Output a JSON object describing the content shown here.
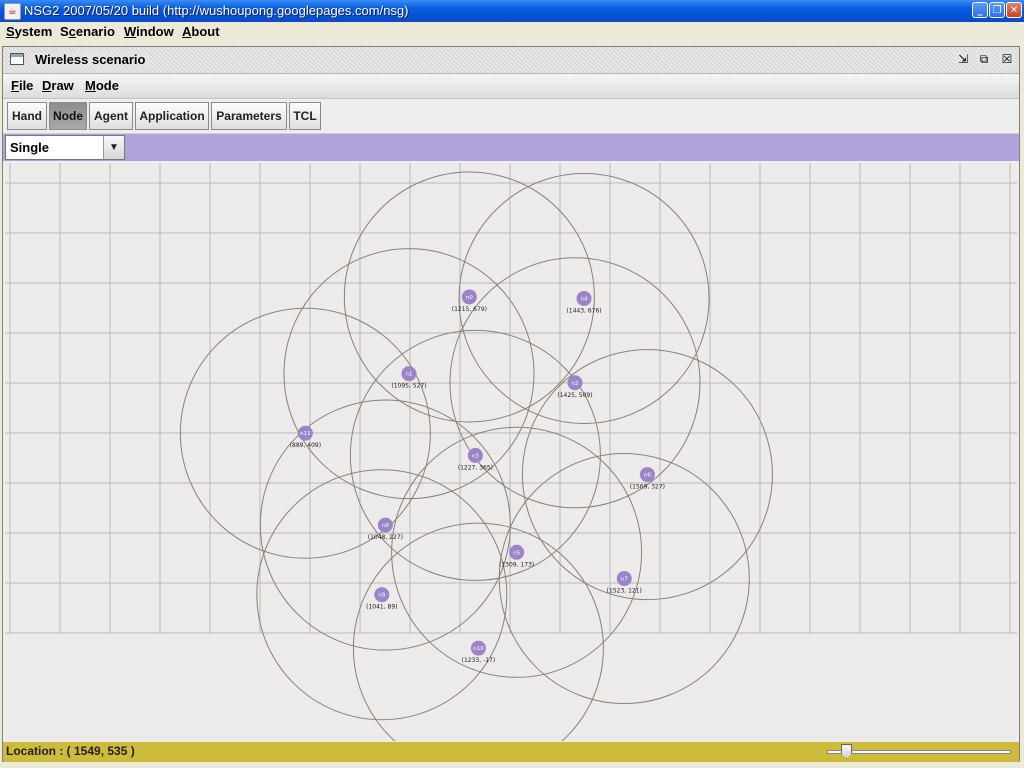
{
  "window": {
    "title": "NSG2 2007/05/20 build (http://wushoupong.googlepages.com/nsg)",
    "app_icon": "java-cup-icon",
    "controls": [
      "minimize-icon",
      "maximize-icon",
      "close-icon"
    ]
  },
  "menubar": {
    "items": [
      {
        "label": "System",
        "mnemonic": "S"
      },
      {
        "label": "Scenario",
        "mnemonic": "c"
      },
      {
        "label": "Window",
        "mnemonic": "W"
      },
      {
        "label": "About",
        "mnemonic": "A"
      }
    ]
  },
  "frame": {
    "title": "Wireless scenario",
    "menu": [
      {
        "label": "File"
      },
      {
        "label": "Draw"
      },
      {
        "label": "Mode"
      }
    ],
    "toolbar": [
      {
        "label": "Hand",
        "active": false
      },
      {
        "label": "Node",
        "active": true
      },
      {
        "label": "Agent",
        "active": false
      },
      {
        "label": "Application",
        "active": false
      },
      {
        "label": "Parameters",
        "active": false
      },
      {
        "label": "TCL",
        "active": false
      }
    ],
    "mode_select": {
      "value": "Single"
    },
    "mode_bar_color": "#b0a3dc",
    "node_color": "#9b84c8",
    "range_color": "#8a7f7a",
    "grid_color": "#b9b9b9"
  },
  "nodes": [
    {
      "id": "n0",
      "label": "n0",
      "coords": "(1215, 679)"
    },
    {
      "id": "n4",
      "label": "n4",
      "coords": "(1443, 676)"
    },
    {
      "id": "n1",
      "label": "n1",
      "coords": "(1095, 527)"
    },
    {
      "id": "n2",
      "label": "n2",
      "coords": "(1425, 509)"
    },
    {
      "id": "n11",
      "label": "n11",
      "coords": "(889, 409)"
    },
    {
      "id": "n3",
      "label": "n3",
      "coords": "(1227, 365)"
    },
    {
      "id": "n6",
      "label": "n6",
      "coords": "(1569, 327)"
    },
    {
      "id": "n8",
      "label": "n8",
      "coords": "(1048, 227)"
    },
    {
      "id": "n5",
      "label": "n5",
      "coords": "(1309, 173)"
    },
    {
      "id": "n7",
      "label": "n7",
      "coords": "(1523, 121)"
    },
    {
      "id": "n9",
      "label": "n9",
      "coords": "(1041, 89)"
    },
    {
      "id": "n10",
      "label": "n10",
      "coords": "(1233, -17)"
    }
  ],
  "status": {
    "location": "Location : ( 1549, 535 )",
    "zoom_fraction": 0.08
  }
}
